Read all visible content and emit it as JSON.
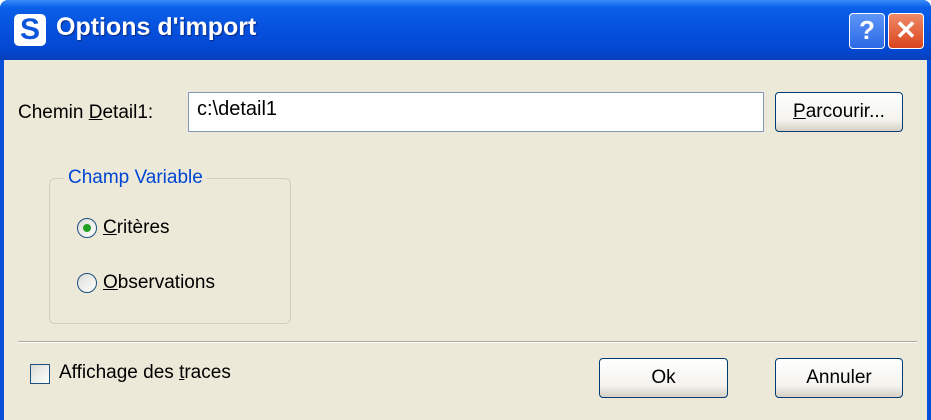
{
  "window": {
    "title": "Options d'import",
    "app_icon_letter": "S",
    "help_symbol": "?",
    "close_symbol": "✕"
  },
  "path": {
    "label_before": "Chemin ",
    "label_mnemonic": "D",
    "label_after": "etail1:",
    "value": "c:\\detail1",
    "browse_mnemonic": "P",
    "browse_rest": "arcourir..."
  },
  "champ": {
    "legend": "Champ Variable",
    "options": [
      {
        "mnemonic": "C",
        "rest": "ritères",
        "selected": true
      },
      {
        "mnemonic": "O",
        "rest": "bservations",
        "selected": false
      }
    ]
  },
  "traces": {
    "before": "Affichage des ",
    "mnemonic": "t",
    "after": "races",
    "checked": false
  },
  "buttons": {
    "ok": "Ok",
    "cancel": "Annuler"
  }
}
